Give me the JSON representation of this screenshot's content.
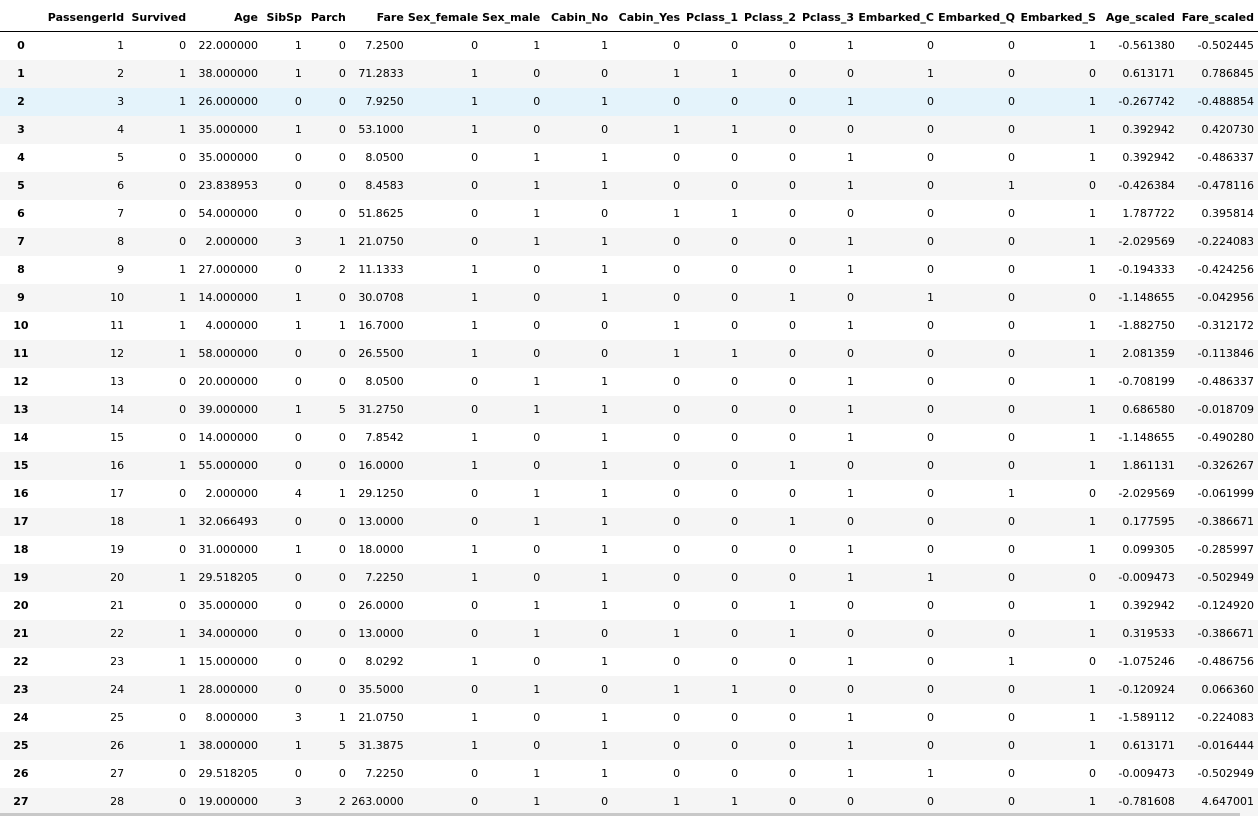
{
  "columns": [
    "",
    "PassengerId",
    "Survived",
    "Age",
    "SibSp",
    "Parch",
    "Fare",
    "Sex_female",
    "Sex_male",
    "Cabin_No",
    "Cabin_Yes",
    "Pclass_1",
    "Pclass_2",
    "Pclass_3",
    "Embarked_C",
    "Embarked_Q",
    "Embarked_S",
    "Age_scaled",
    "Fare_scaled"
  ],
  "highlighted_row": 2,
  "rows": [
    [
      "0",
      "1",
      "0",
      "22.000000",
      "1",
      "0",
      "7.2500",
      "0",
      "1",
      "1",
      "0",
      "0",
      "0",
      "1",
      "0",
      "0",
      "1",
      "-0.561380",
      "-0.502445"
    ],
    [
      "1",
      "2",
      "1",
      "38.000000",
      "1",
      "0",
      "71.2833",
      "1",
      "0",
      "0",
      "1",
      "1",
      "0",
      "0",
      "1",
      "0",
      "0",
      "0.613171",
      "0.786845"
    ],
    [
      "2",
      "3",
      "1",
      "26.000000",
      "0",
      "0",
      "7.9250",
      "1",
      "0",
      "1",
      "0",
      "0",
      "0",
      "1",
      "0",
      "0",
      "1",
      "-0.267742",
      "-0.488854"
    ],
    [
      "3",
      "4",
      "1",
      "35.000000",
      "1",
      "0",
      "53.1000",
      "1",
      "0",
      "0",
      "1",
      "1",
      "0",
      "0",
      "0",
      "0",
      "1",
      "0.392942",
      "0.420730"
    ],
    [
      "4",
      "5",
      "0",
      "35.000000",
      "0",
      "0",
      "8.0500",
      "0",
      "1",
      "1",
      "0",
      "0",
      "0",
      "1",
      "0",
      "0",
      "1",
      "0.392942",
      "-0.486337"
    ],
    [
      "5",
      "6",
      "0",
      "23.838953",
      "0",
      "0",
      "8.4583",
      "0",
      "1",
      "1",
      "0",
      "0",
      "0",
      "1",
      "0",
      "1",
      "0",
      "-0.426384",
      "-0.478116"
    ],
    [
      "6",
      "7",
      "0",
      "54.000000",
      "0",
      "0",
      "51.8625",
      "0",
      "1",
      "0",
      "1",
      "1",
      "0",
      "0",
      "0",
      "0",
      "1",
      "1.787722",
      "0.395814"
    ],
    [
      "7",
      "8",
      "0",
      "2.000000",
      "3",
      "1",
      "21.0750",
      "0",
      "1",
      "1",
      "0",
      "0",
      "0",
      "1",
      "0",
      "0",
      "1",
      "-2.029569",
      "-0.224083"
    ],
    [
      "8",
      "9",
      "1",
      "27.000000",
      "0",
      "2",
      "11.1333",
      "1",
      "0",
      "1",
      "0",
      "0",
      "0",
      "1",
      "0",
      "0",
      "1",
      "-0.194333",
      "-0.424256"
    ],
    [
      "9",
      "10",
      "1",
      "14.000000",
      "1",
      "0",
      "30.0708",
      "1",
      "0",
      "1",
      "0",
      "0",
      "1",
      "0",
      "1",
      "0",
      "0",
      "-1.148655",
      "-0.042956"
    ],
    [
      "10",
      "11",
      "1",
      "4.000000",
      "1",
      "1",
      "16.7000",
      "1",
      "0",
      "0",
      "1",
      "0",
      "0",
      "1",
      "0",
      "0",
      "1",
      "-1.882750",
      "-0.312172"
    ],
    [
      "11",
      "12",
      "1",
      "58.000000",
      "0",
      "0",
      "26.5500",
      "1",
      "0",
      "0",
      "1",
      "1",
      "0",
      "0",
      "0",
      "0",
      "1",
      "2.081359",
      "-0.113846"
    ],
    [
      "12",
      "13",
      "0",
      "20.000000",
      "0",
      "0",
      "8.0500",
      "0",
      "1",
      "1",
      "0",
      "0",
      "0",
      "1",
      "0",
      "0",
      "1",
      "-0.708199",
      "-0.486337"
    ],
    [
      "13",
      "14",
      "0",
      "39.000000",
      "1",
      "5",
      "31.2750",
      "0",
      "1",
      "1",
      "0",
      "0",
      "0",
      "1",
      "0",
      "0",
      "1",
      "0.686580",
      "-0.018709"
    ],
    [
      "14",
      "15",
      "0",
      "14.000000",
      "0",
      "0",
      "7.8542",
      "1",
      "0",
      "1",
      "0",
      "0",
      "0",
      "1",
      "0",
      "0",
      "1",
      "-1.148655",
      "-0.490280"
    ],
    [
      "15",
      "16",
      "1",
      "55.000000",
      "0",
      "0",
      "16.0000",
      "1",
      "0",
      "1",
      "0",
      "0",
      "1",
      "0",
      "0",
      "0",
      "1",
      "1.861131",
      "-0.326267"
    ],
    [
      "16",
      "17",
      "0",
      "2.000000",
      "4",
      "1",
      "29.1250",
      "0",
      "1",
      "1",
      "0",
      "0",
      "0",
      "1",
      "0",
      "1",
      "0",
      "-2.029569",
      "-0.061999"
    ],
    [
      "17",
      "18",
      "1",
      "32.066493",
      "0",
      "0",
      "13.0000",
      "0",
      "1",
      "1",
      "0",
      "0",
      "1",
      "0",
      "0",
      "0",
      "1",
      "0.177595",
      "-0.386671"
    ],
    [
      "18",
      "19",
      "0",
      "31.000000",
      "1",
      "0",
      "18.0000",
      "1",
      "0",
      "1",
      "0",
      "0",
      "0",
      "1",
      "0",
      "0",
      "1",
      "0.099305",
      "-0.285997"
    ],
    [
      "19",
      "20",
      "1",
      "29.518205",
      "0",
      "0",
      "7.2250",
      "1",
      "0",
      "1",
      "0",
      "0",
      "0",
      "1",
      "1",
      "0",
      "0",
      "-0.009473",
      "-0.502949"
    ],
    [
      "20",
      "21",
      "0",
      "35.000000",
      "0",
      "0",
      "26.0000",
      "0",
      "1",
      "1",
      "0",
      "0",
      "1",
      "0",
      "0",
      "0",
      "1",
      "0.392942",
      "-0.124920"
    ],
    [
      "21",
      "22",
      "1",
      "34.000000",
      "0",
      "0",
      "13.0000",
      "0",
      "1",
      "0",
      "1",
      "0",
      "1",
      "0",
      "0",
      "0",
      "1",
      "0.319533",
      "-0.386671"
    ],
    [
      "22",
      "23",
      "1",
      "15.000000",
      "0",
      "0",
      "8.0292",
      "1",
      "0",
      "1",
      "0",
      "0",
      "0",
      "1",
      "0",
      "1",
      "0",
      "-1.075246",
      "-0.486756"
    ],
    [
      "23",
      "24",
      "1",
      "28.000000",
      "0",
      "0",
      "35.5000",
      "0",
      "1",
      "0",
      "1",
      "1",
      "0",
      "0",
      "0",
      "0",
      "1",
      "-0.120924",
      "0.066360"
    ],
    [
      "24",
      "25",
      "0",
      "8.000000",
      "3",
      "1",
      "21.0750",
      "1",
      "0",
      "1",
      "0",
      "0",
      "0",
      "1",
      "0",
      "0",
      "1",
      "-1.589112",
      "-0.224083"
    ],
    [
      "25",
      "26",
      "1",
      "38.000000",
      "1",
      "5",
      "31.3875",
      "1",
      "0",
      "1",
      "0",
      "0",
      "0",
      "1",
      "0",
      "0",
      "1",
      "0.613171",
      "-0.016444"
    ],
    [
      "26",
      "27",
      "0",
      "29.518205",
      "0",
      "0",
      "7.2250",
      "0",
      "1",
      "1",
      "0",
      "0",
      "0",
      "1",
      "1",
      "0",
      "0",
      "-0.009473",
      "-0.502949"
    ],
    [
      "27",
      "28",
      "0",
      "19.000000",
      "3",
      "2",
      "263.0000",
      "0",
      "1",
      "0",
      "1",
      "1",
      "0",
      "0",
      "0",
      "0",
      "1",
      "-0.781608",
      "4.647001"
    ]
  ]
}
